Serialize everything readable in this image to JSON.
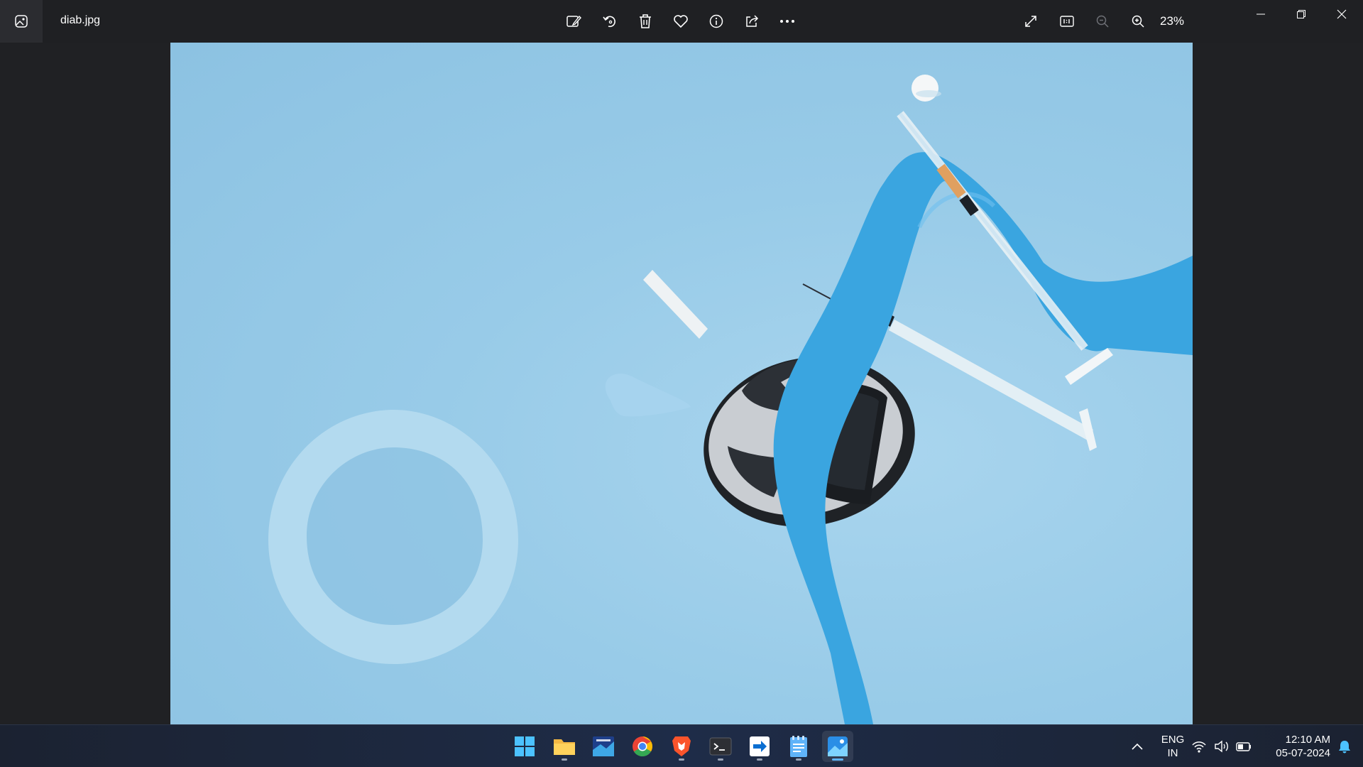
{
  "window": {
    "filename": "diab.jpg",
    "zoom_label": "23%"
  },
  "toolbar": {
    "icons": [
      "edit-image-icon",
      "rotate-icon",
      "delete-icon",
      "favorite-icon",
      "info-icon",
      "share-icon",
      "more-icon"
    ],
    "right_icons": [
      "fullscreen-icon",
      "actual-size-icon",
      "zoom-out-icon",
      "zoom-in-icon"
    ]
  },
  "colors": {
    "titlebar": "#1f2023",
    "photo_bg": "#98cbe8",
    "ribbon": "#3aa5e0",
    "taskbar_accent": "#5fb3f9"
  },
  "taskbar": {
    "apps": [
      "start",
      "file-explorer",
      "desktop-app",
      "chrome",
      "brave",
      "terminal",
      "remote-app",
      "notepad",
      "photos"
    ],
    "active_app": "photos"
  },
  "tray": {
    "lang_top": "ENG",
    "lang_bottom": "IN",
    "time": "12:10 AM",
    "date": "05-07-2024"
  }
}
